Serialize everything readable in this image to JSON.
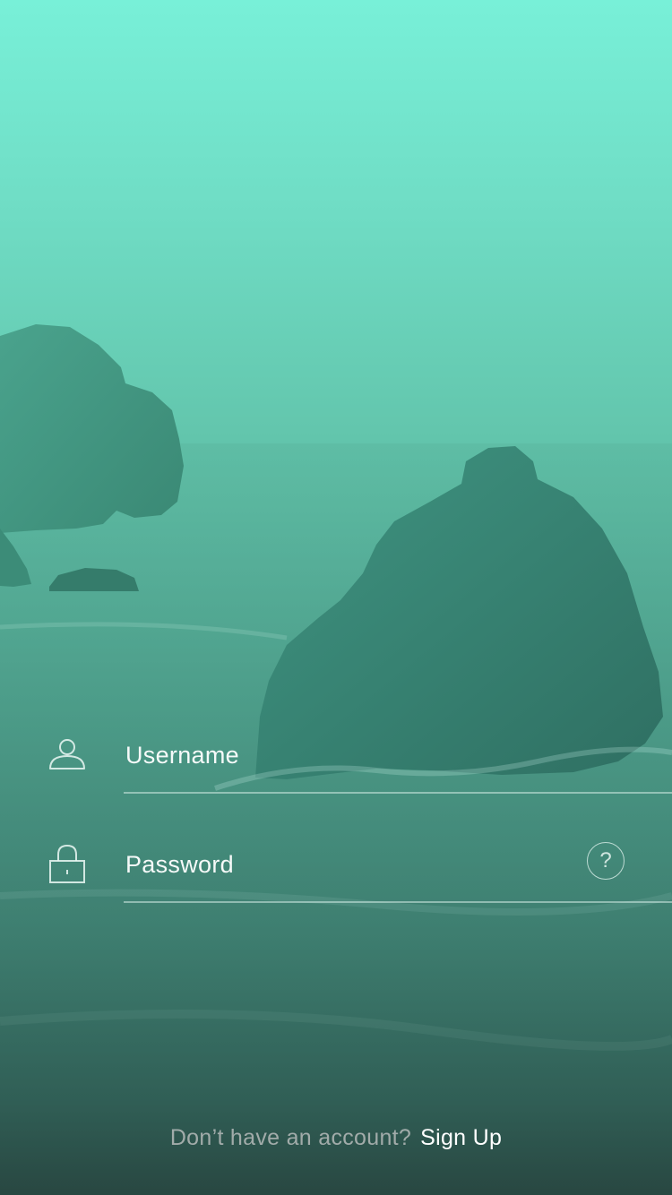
{
  "login": {
    "username": {
      "placeholder": "Username",
      "icon": "user-icon"
    },
    "password": {
      "placeholder": "Password",
      "icon": "lock-icon",
      "help_icon": "question-mark-icon",
      "help_label": "?"
    }
  },
  "footer": {
    "prompt": "Don’t have an account?",
    "signup_label": "Sign Up"
  },
  "colors": {
    "gradient_top": "#78f0d8",
    "gradient_bottom": "#1e2524",
    "text_primary": "#ffffff",
    "text_muted": "#c8c8c8"
  }
}
